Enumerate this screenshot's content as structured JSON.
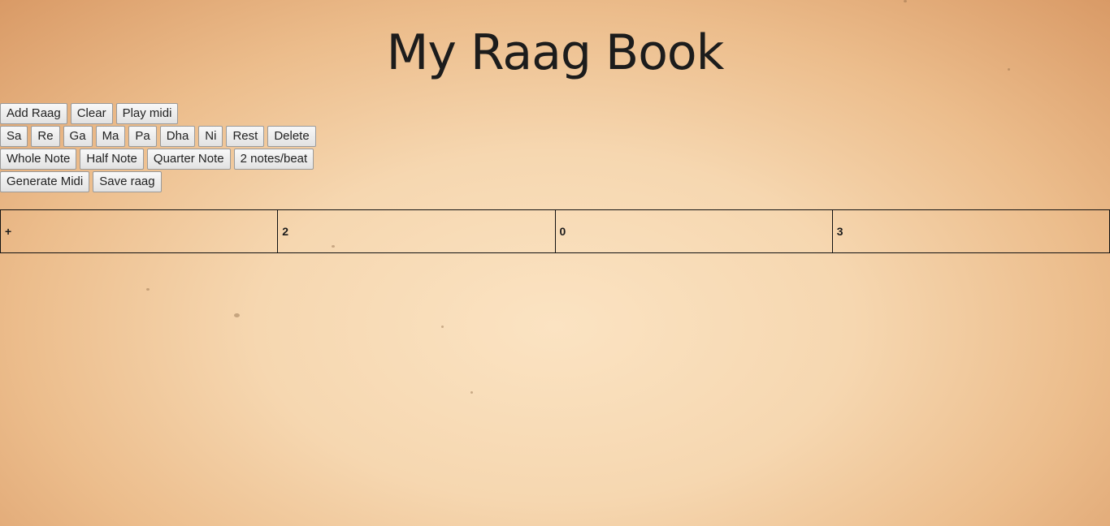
{
  "page": {
    "title": "My Raag Book"
  },
  "toolbar": {
    "row1": [
      "Add Raag",
      "Clear",
      "Play midi"
    ],
    "row2": [
      "Sa",
      "Re",
      "Ga",
      "Ma",
      "Pa",
      "Dha",
      "Ni",
      "Rest",
      "Delete"
    ],
    "row3": [
      "Whole Note",
      "Half Note",
      "Quarter Note",
      "2 notes/beat"
    ],
    "row4": [
      "Generate Midi",
      "Save raag"
    ]
  },
  "beat_grid": {
    "cells": [
      "+",
      "2",
      "0",
      "3"
    ]
  },
  "colors": {
    "title": "#1c1c1c",
    "paper_center": "#fbe3c2",
    "paper_edge": "#d99a66",
    "grid_border": "#111111"
  }
}
